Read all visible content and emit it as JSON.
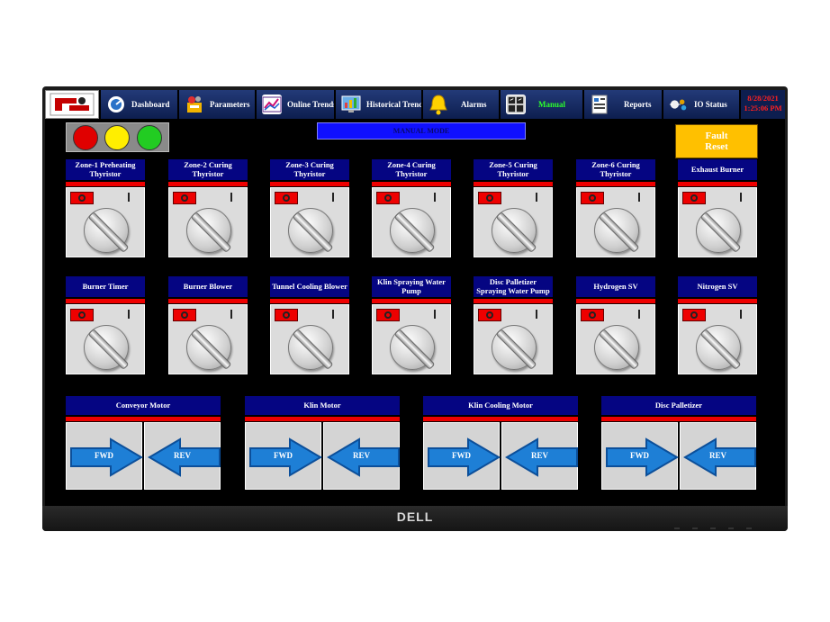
{
  "nav": {
    "items": [
      {
        "label": "Dashboard",
        "icon": "dashboard-gauge-icon"
      },
      {
        "label": "Parameters",
        "icon": "parameters-icon"
      },
      {
        "label": "Online Trends",
        "icon": "online-trends-icon"
      },
      {
        "label": "Historical Trends",
        "icon": "historical-trends-icon"
      },
      {
        "label": "Alarms",
        "icon": "alarm-bell-icon"
      },
      {
        "label": "Manual",
        "icon": "manual-icon",
        "active": true
      },
      {
        "label": "Reports",
        "icon": "reports-icon"
      },
      {
        "label": "IO Status",
        "icon": "io-status-icon"
      }
    ],
    "date": "8/28/2021",
    "time": "1:25:06 PM"
  },
  "indicators": {
    "lamps": [
      "#e00000",
      "#ffee00",
      "#22cc22"
    ]
  },
  "mode_banner": "MANUAL MODE",
  "fault_reset": {
    "line1": "Fault",
    "line2": "Reset"
  },
  "switch_labels": {
    "off": "O",
    "on": "I"
  },
  "selector_rows": [
    [
      {
        "title": "Zone-1 Preheating Thyristor"
      },
      {
        "title": "Zone-2 Curing Thyristor"
      },
      {
        "title": "Zone-3 Curing Thyristor"
      },
      {
        "title": "Zone-4 Curing Thyristor"
      },
      {
        "title": "Zone-5 Curing Thyristor"
      },
      {
        "title": "Zone-6 Curing Thyristor"
      },
      {
        "title": "Exhaust Burner"
      }
    ],
    [
      {
        "title": "Burner Timer"
      },
      {
        "title": "Burner Blower"
      },
      {
        "title": "Tunnel Cooling Blower"
      },
      {
        "title": "Klin Spraying Water Pump"
      },
      {
        "title": "Disc Palletizer Spraying Water Pump"
      },
      {
        "title": "Hydrogen SV"
      },
      {
        "title": "Nitrogen SV"
      }
    ]
  ],
  "motors": [
    {
      "title": "Conveyor Motor",
      "fwd": "FWD",
      "rev": "REV"
    },
    {
      "title": "Klin Motor",
      "fwd": "FWD",
      "rev": "REV"
    },
    {
      "title": "Klin Cooling Motor",
      "fwd": "FWD",
      "rev": "REV"
    },
    {
      "title": "Disc Palletizer",
      "fwd": "FWD",
      "rev": "REV"
    }
  ],
  "monitor_brand": "DELL",
  "colors": {
    "nav_active": "#2cff2c",
    "title_bar": "#050582",
    "accent_red": "#e00000",
    "arrow_blue": "#1e7fd6"
  }
}
